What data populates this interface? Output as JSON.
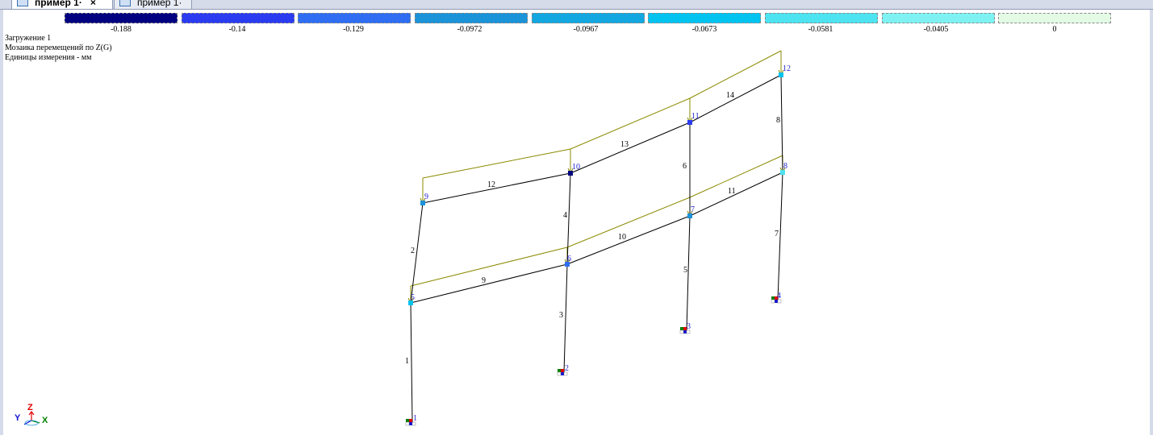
{
  "tabs": [
    {
      "label": "пример 1·",
      "close": "×",
      "active": true
    },
    {
      "label": "пример 1·",
      "active": false
    }
  ],
  "scale": {
    "colors": [
      "#000080",
      "#2b3cf0",
      "#2f6ef2",
      "#1b93d8",
      "#12a7e0",
      "#00c3f0",
      "#4de3f0",
      "#7ef2f2",
      "#e3fbe5"
    ],
    "values": [
      "-0.188",
      "-0.14",
      "-0.129",
      "-0.0972",
      "-0.0967",
      "-0.0673",
      "-0.0581",
      "-0.0405",
      "0"
    ]
  },
  "info": {
    "line1": "Загружение 1",
    "line2": "Мозаика перемещений по Z(G)",
    "line3": "Единицы измерения - мм"
  },
  "model": {
    "node_colors": {
      "n5": "#00c3f0",
      "n6": "#2f6ef2",
      "n7": "#1b93d8",
      "n8": "#4de3f0",
      "n9": "#1b93d8",
      "n10": "#000080",
      "n11": "#2b3cf0",
      "n12": "#00c3f0"
    },
    "nodes": [
      "1",
      "2",
      "3",
      "4",
      "5",
      "6",
      "7",
      "8",
      "9",
      "10",
      "11",
      "12"
    ],
    "elements": [
      "1",
      "2",
      "3",
      "4",
      "5",
      "6",
      "7",
      "8",
      "9",
      "10",
      "11",
      "12",
      "13",
      "14"
    ]
  },
  "axes": {
    "z": "Z",
    "y": "Y",
    "x": "X",
    "z_color": "#e00000",
    "y_color": "#1010d0",
    "x_color": "#008000"
  }
}
